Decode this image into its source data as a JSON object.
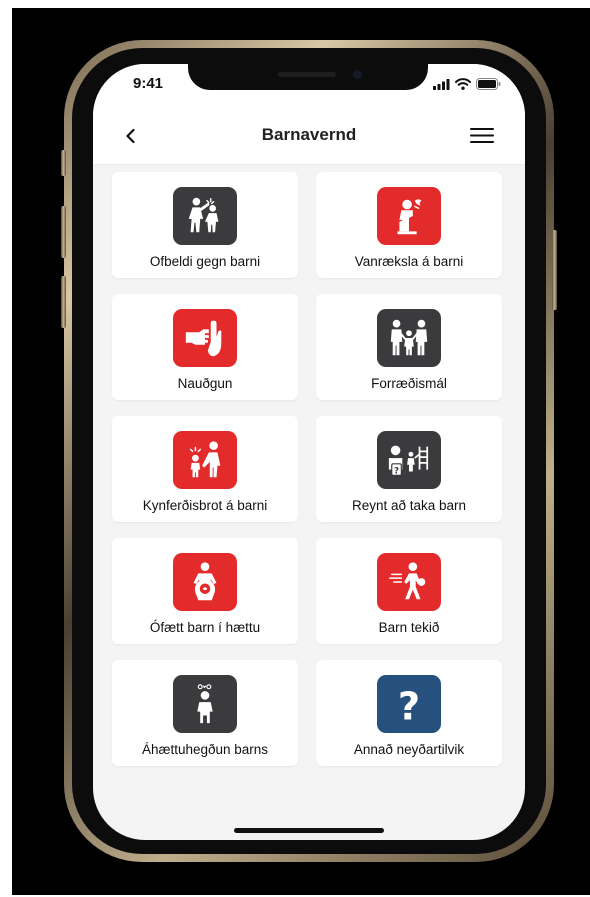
{
  "status_bar": {
    "time": "9:41"
  },
  "nav": {
    "title": "Barnavernd"
  },
  "colors": {
    "red": "#e42b2b",
    "dark": "#3b3b3d",
    "blue": "#26507e"
  },
  "categories": [
    {
      "label": "Ofbeldi gegn barni",
      "icon": "child-violence-icon",
      "color": "dark"
    },
    {
      "label": "Vanræksla á barni",
      "icon": "child-neglect-icon",
      "color": "red"
    },
    {
      "label": "Nauðgun",
      "icon": "rape-icon",
      "color": "red"
    },
    {
      "label": "Forræðismál",
      "icon": "custody-family-icon",
      "color": "dark"
    },
    {
      "label": "Kynferðisbrot á barni",
      "icon": "child-sexual-abuse-icon",
      "color": "red"
    },
    {
      "label": "Reynt að taka barn",
      "icon": "attempted-abduction-icon",
      "color": "dark"
    },
    {
      "label": "Ófætt barn í hættu",
      "icon": "unborn-child-danger-icon",
      "color": "red"
    },
    {
      "label": "Barn tekið",
      "icon": "child-taken-icon",
      "color": "red"
    },
    {
      "label": "Áhættuhegðun barns",
      "icon": "risk-behavior-icon",
      "color": "dark"
    },
    {
      "label": "Annað neyðartilvik",
      "icon": "question-icon",
      "color": "blue"
    }
  ]
}
